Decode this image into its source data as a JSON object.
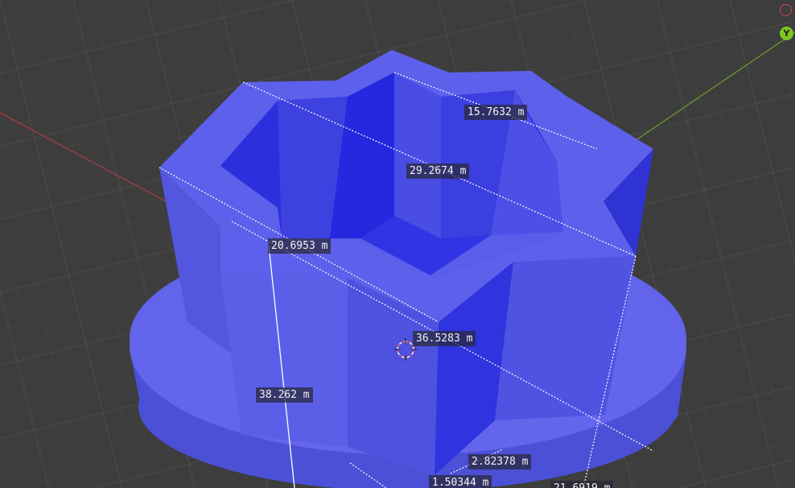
{
  "viewport": {
    "background": "#3d3d3d",
    "object_color": "#5b5ee9",
    "measurements": [
      {
        "value": "15.7632 m"
      },
      {
        "value": "29.2674 m"
      },
      {
        "value": "20.6953 m"
      },
      {
        "value": "36.5283 m"
      },
      {
        "value": "38.262 m"
      },
      {
        "value": "2.82378 m"
      },
      {
        "value": "1.50344 m"
      },
      {
        "value": "21.6919 m"
      }
    ],
    "gizmo": {
      "y_axis_label": "Y",
      "y_axis_color": "#7fc41f",
      "x_axis_color": "#d2424a"
    },
    "icons": [
      "3d-cursor-icon",
      "axis-gizmo-icon"
    ]
  }
}
